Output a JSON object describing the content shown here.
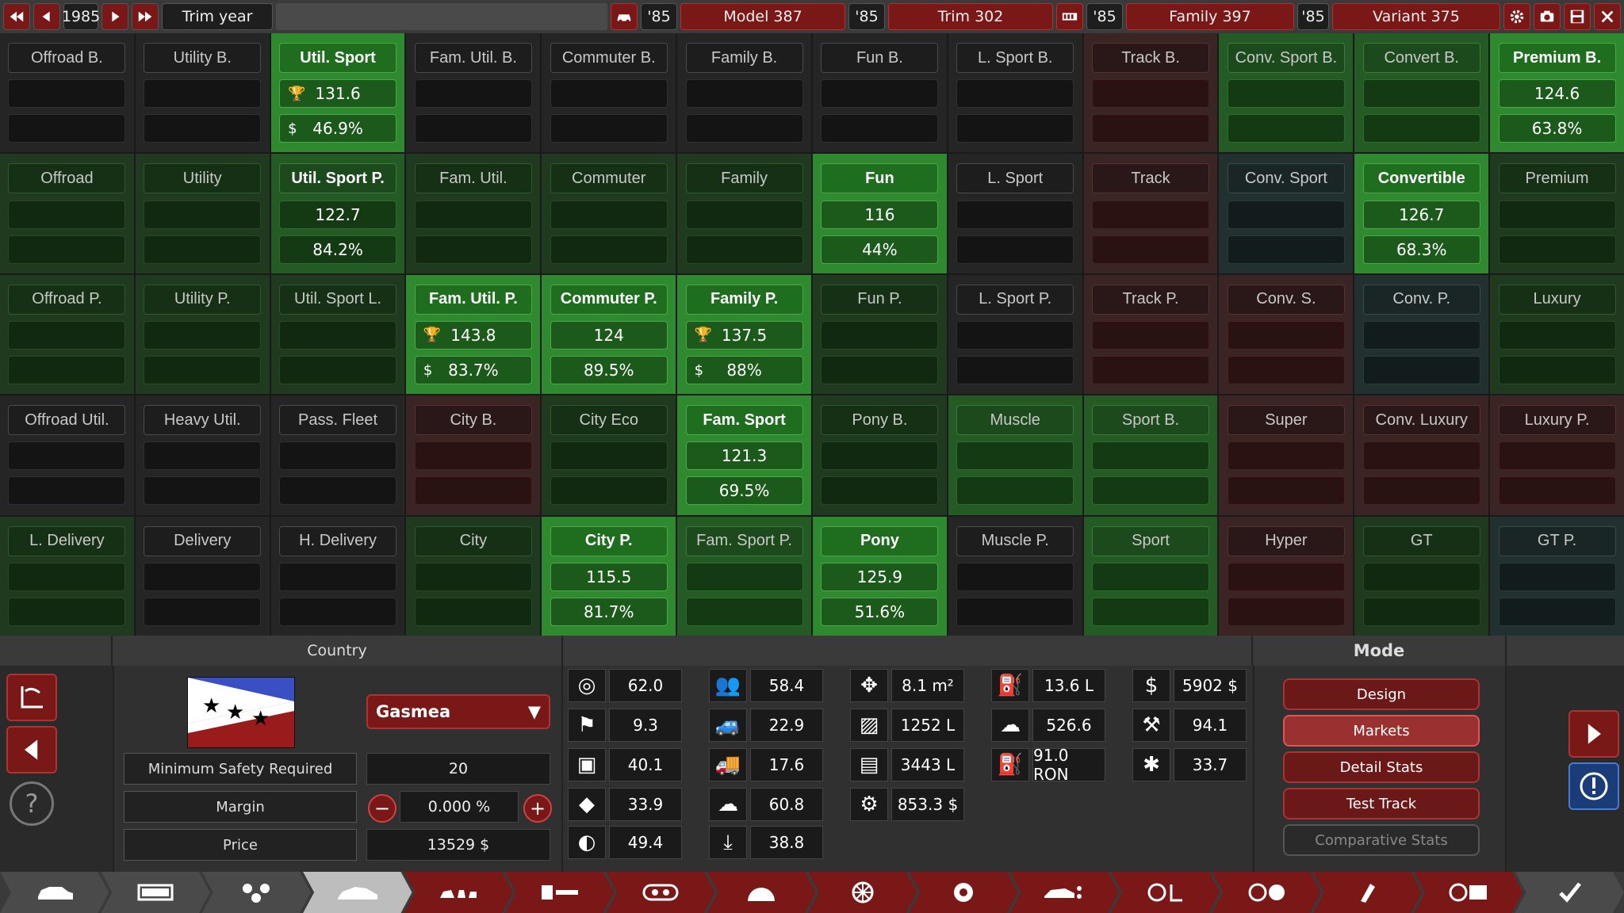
{
  "topbar": {
    "year": "1985",
    "trim_year_label": "Trim year",
    "model_year": "'85",
    "model_label": "Model 387",
    "trim_year": "'85",
    "trim_label": "Trim 302",
    "family_year": "'85",
    "family_label": "Family 397",
    "variant_year": "'85",
    "variant_label": "Variant 375"
  },
  "grid": [
    [
      {
        "name": "Offroad B.",
        "style": "dark"
      },
      {
        "name": "Utility B.",
        "style": "dark"
      },
      {
        "name": "Util. Sport",
        "style": "bgreen",
        "v1": "131.6",
        "v2": "46.9%",
        "icons": true
      },
      {
        "name": "Fam. Util. B.",
        "style": "dark"
      },
      {
        "name": "Commuter B.",
        "style": "dark"
      },
      {
        "name": "Family B.",
        "style": "dark"
      },
      {
        "name": "Fun B.",
        "style": "dark"
      },
      {
        "name": "L. Sport B.",
        "style": "dark"
      },
      {
        "name": "Track B.",
        "style": "red"
      },
      {
        "name": "Conv. Sport B.",
        "style": "mgreen"
      },
      {
        "name": "Convert B.",
        "style": "mgreen"
      },
      {
        "name": "Premium B.",
        "style": "bgreen",
        "v1": "124.6",
        "v2": "63.8%"
      }
    ],
    [
      {
        "name": "Offroad",
        "style": "dgreen"
      },
      {
        "name": "Utility",
        "style": "dgreen"
      },
      {
        "name": "Util. Sport P.",
        "style": "mgreen",
        "v1": "122.7",
        "v2": "84.2%",
        "bold": true
      },
      {
        "name": "Fam. Util.",
        "style": "dgreen"
      },
      {
        "name": "Commuter",
        "style": "dgreen"
      },
      {
        "name": "Family",
        "style": "dgreen"
      },
      {
        "name": "Fun",
        "style": "bgreen",
        "v1": "116",
        "v2": "44%"
      },
      {
        "name": "L. Sport",
        "style": "dark"
      },
      {
        "name": "Track",
        "style": "red"
      },
      {
        "name": "Conv. Sport",
        "style": "teal"
      },
      {
        "name": "Convertible",
        "style": "bgreen",
        "v1": "126.7",
        "v2": "68.3%"
      },
      {
        "name": "Premium",
        "style": "dgreen"
      }
    ],
    [
      {
        "name": "Offroad P.",
        "style": "dgreen"
      },
      {
        "name": "Utility P.",
        "style": "dgreen"
      },
      {
        "name": "Util. Sport L.",
        "style": "dgreen"
      },
      {
        "name": "Fam. Util. P.",
        "style": "bgreen",
        "v1": "143.8",
        "v2": "83.7%",
        "icons": true
      },
      {
        "name": "Commuter P.",
        "style": "bgreen",
        "v1": "124",
        "v2": "89.5%"
      },
      {
        "name": "Family P.",
        "style": "bgreen",
        "v1": "137.5",
        "v2": "88%",
        "icons": true
      },
      {
        "name": "Fun P.",
        "style": "dgreen"
      },
      {
        "name": "L. Sport P.",
        "style": "dark"
      },
      {
        "name": "Track P.",
        "style": "red"
      },
      {
        "name": "Conv. S.",
        "style": "red"
      },
      {
        "name": "Conv. P.",
        "style": "teal"
      },
      {
        "name": "Luxury",
        "style": "dgreen"
      }
    ],
    [
      {
        "name": "Offroad Util.",
        "style": "dark"
      },
      {
        "name": "Heavy Util.",
        "style": "dark"
      },
      {
        "name": "Pass. Fleet",
        "style": "dark"
      },
      {
        "name": "City B.",
        "style": "red"
      },
      {
        "name": "City Eco",
        "style": "dgreen"
      },
      {
        "name": "Fam. Sport",
        "style": "bgreen",
        "v1": "121.3",
        "v2": "69.5%"
      },
      {
        "name": "Pony B.",
        "style": "dgreen"
      },
      {
        "name": "Muscle",
        "style": "mgreen"
      },
      {
        "name": "Sport B.",
        "style": "mgreen"
      },
      {
        "name": "Super",
        "style": "red"
      },
      {
        "name": "Conv. Luxury",
        "style": "red"
      },
      {
        "name": "Luxury P.",
        "style": "red"
      }
    ],
    [
      {
        "name": "L. Delivery",
        "style": "dgreen"
      },
      {
        "name": "Delivery",
        "style": "dark"
      },
      {
        "name": "H. Delivery",
        "style": "dark"
      },
      {
        "name": "City",
        "style": "dgreen"
      },
      {
        "name": "City P.",
        "style": "bgreen",
        "v1": "115.5",
        "v2": "81.7%"
      },
      {
        "name": "Fam. Sport P.",
        "style": "mgreen"
      },
      {
        "name": "Pony",
        "style": "bgreen",
        "v1": "125.9",
        "v2": "51.6%"
      },
      {
        "name": "Muscle P.",
        "style": "dark"
      },
      {
        "name": "Sport",
        "style": "mgreen"
      },
      {
        "name": "Hyper",
        "style": "red"
      },
      {
        "name": "GT",
        "style": "dgreen"
      },
      {
        "name": "GT P.",
        "style": "teal"
      }
    ]
  ],
  "country": {
    "header": "Country",
    "selected": "Gasmea",
    "min_safety_label": "Minimum Safety Required",
    "min_safety_value": "20",
    "margin_label": "Margin",
    "margin_value": "0.000 %",
    "price_label": "Price",
    "price_value": "13529 $"
  },
  "stats": [
    {
      "icon": "steering-wheel-icon",
      "value": "62.0"
    },
    {
      "icon": "race-flag-icon",
      "value": "9.3"
    },
    {
      "icon": "seat-icon",
      "value": "40.1"
    },
    {
      "icon": "diamond-icon",
      "value": "33.9"
    },
    {
      "icon": "safety-icon",
      "value": "49.4"
    },
    {
      "icon": "passengers-icon",
      "value": "58.4"
    },
    {
      "icon": "offroad-car-icon",
      "value": "22.9"
    },
    {
      "icon": "utility-car-icon",
      "value": "17.6"
    },
    {
      "icon": "environment-icon",
      "value": "60.8"
    },
    {
      "icon": "drivability-icon",
      "value": "38.8"
    },
    {
      "icon": "dimensions-icon",
      "value": "8.1 m²"
    },
    {
      "icon": "cargo-volume-icon",
      "value": "1252 L"
    },
    {
      "icon": "passenger-volume-icon",
      "value": "3443 L"
    },
    {
      "icon": "cost-icon",
      "value": "853.3 $"
    },
    {
      "icon": "fuel-tank-icon",
      "value": "13.6 L"
    },
    {
      "icon": "emissions-icon",
      "value": "526.6"
    },
    {
      "icon": "fuel-pump-icon",
      "value": "91.0 RON"
    },
    {
      "icon": "engineering-cost-icon",
      "value": "5902 $"
    },
    {
      "icon": "production-icon",
      "value": "94.1"
    },
    {
      "icon": "service-icon",
      "value": "33.7"
    }
  ],
  "mode": {
    "header": "Mode",
    "buttons": [
      "Design",
      "Markets",
      "Detail Stats",
      "Test Track",
      "Comparative Stats"
    ]
  },
  "colors": {
    "accent_red": "#7a1717",
    "bright_green": "#2f8a2f",
    "dark_green": "#1f3a1f"
  }
}
